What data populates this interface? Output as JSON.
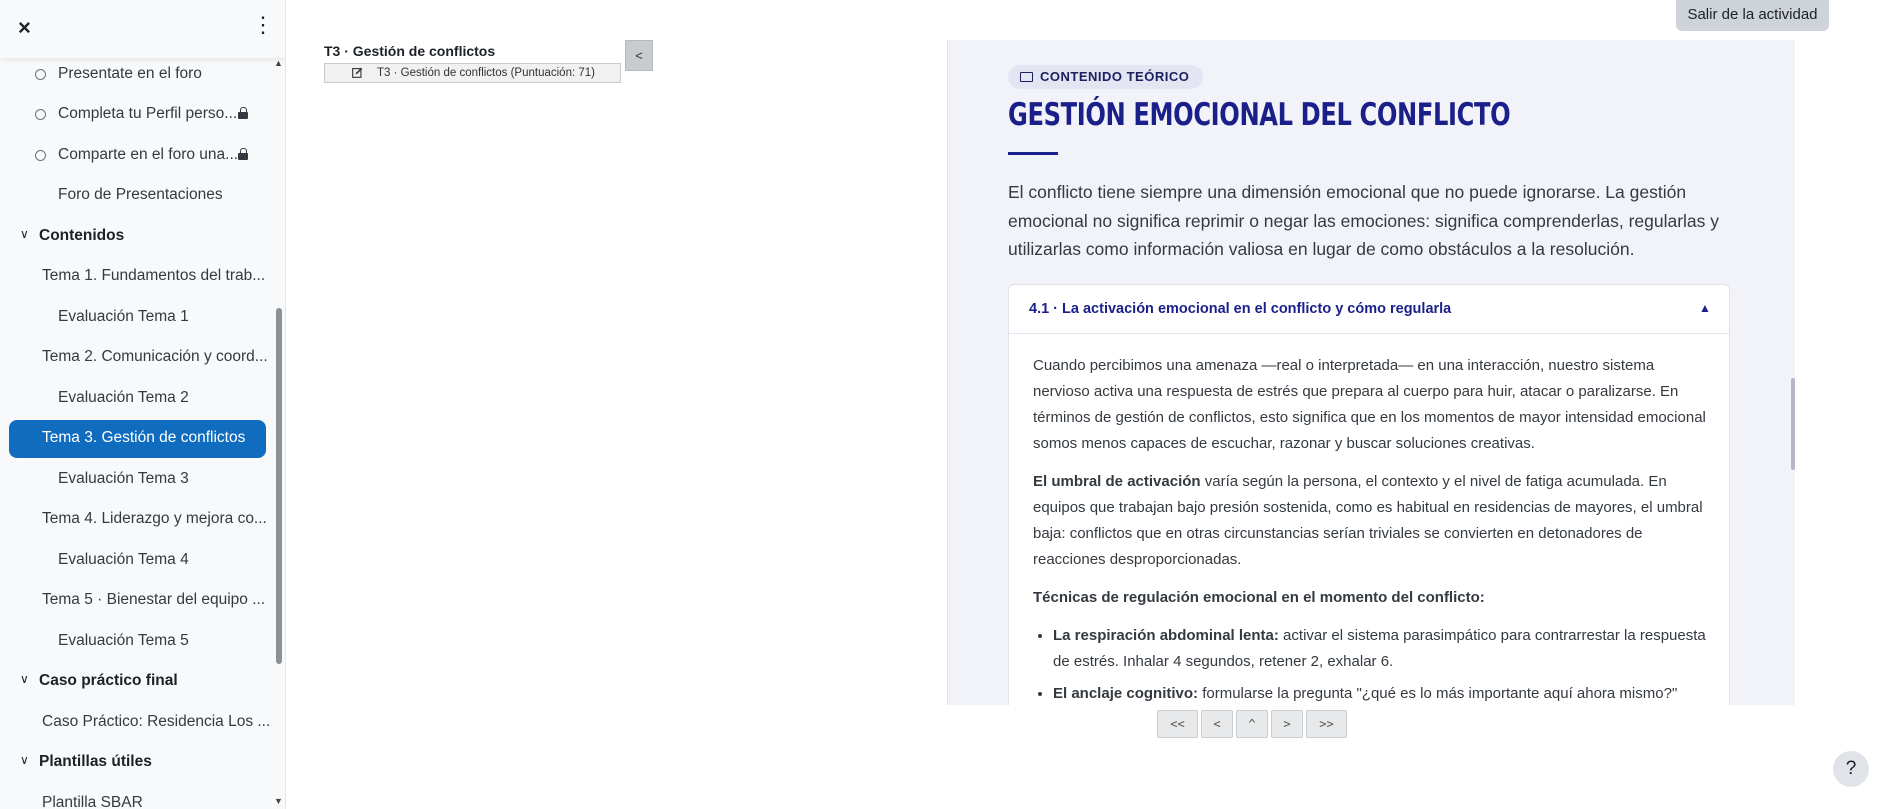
{
  "sidebar": {
    "close_label": "×",
    "menu_label": "⋮",
    "items": [
      {
        "label": "Presentate en el foro",
        "kind": "activity-check"
      },
      {
        "label": "Completa tu Perfil perso...",
        "kind": "activity-check-locked"
      },
      {
        "label": "Comparte en el foro una...",
        "kind": "activity-check-locked"
      },
      {
        "label": "Foro de Presentaciones",
        "kind": "activity"
      },
      {
        "label": "Contenidos",
        "kind": "section"
      },
      {
        "label": "Tema 1. Fundamentos del trab...",
        "kind": "page"
      },
      {
        "label": "Evaluación Tema 1",
        "kind": "activity"
      },
      {
        "label": "Tema 2. Comunicación y coord...",
        "kind": "page"
      },
      {
        "label": "Evaluación Tema 2",
        "kind": "activity"
      },
      {
        "label": "Tema 3. Gestión de conflictos",
        "kind": "page-active"
      },
      {
        "label": "Evaluación Tema 3",
        "kind": "activity"
      },
      {
        "label": "Tema 4. Liderazgo y mejora co...",
        "kind": "page"
      },
      {
        "label": "Evaluación Tema 4",
        "kind": "activity"
      },
      {
        "label": "Tema 5 · Bienestar del equipo ...",
        "kind": "page"
      },
      {
        "label": "Evaluación Tema 5",
        "kind": "activity"
      },
      {
        "label": "Caso práctico final",
        "kind": "section"
      },
      {
        "label": "Caso Práctico: Residencia Los ...",
        "kind": "page"
      },
      {
        "label": "Plantillas útiles",
        "kind": "section"
      },
      {
        "label": "Plantilla SBAR",
        "kind": "page"
      }
    ]
  },
  "header": {
    "exit_label": "Salir de la actividad"
  },
  "activity_nav": {
    "title": "T3 · Gestión de conflictos",
    "item_label": "T3 · Gestión de conflictos (Puntuación: 71)",
    "collapse_label": "<"
  },
  "content": {
    "tag": "CONTENIDO TEÓRICO",
    "title": "GESTIÓN EMOCIONAL DEL CONFLICTO",
    "intro": "El conflicto tiene siempre una dimensión emocional que no puede ignorarse. La gestión emocional no significa reprimir o negar las emociones: significa comprenderlas, regularlas y utilizarlas como información valiosa en lugar de como obstáculos a la resolución.",
    "accordion": {
      "title": "4.1 · La activación emocional en el conflicto y cómo regularla",
      "toggle": "▲",
      "p1": "Cuando percibimos una amenaza —real o interpretada— en una interacción, nuestro sistema nervioso activa una respuesta de estrés que prepara al cuerpo para huir, atacar o paralizarse. En términos de gestión de conflictos, esto significa que en los momentos de mayor intensidad emocional somos menos capaces de escuchar, razonar y buscar soluciones creativas.",
      "p2_bold": "El umbral de activación",
      "p2_rest": " varía según la persona, el contexto y el nivel de fatiga acumulada. En equipos que trabajan bajo presión sostenida, como es habitual en residencias de mayores, el umbral baja: conflictos que en otras circunstancias serían triviales se convierten en detonadores de reacciones desproporcionadas.",
      "p3": "Técnicas de regulación emocional en el momento del conflicto:",
      "li1_bold": "La respiración abdominal lenta:",
      "li1_rest": " activar el sistema parasimpático para contrarrestar la respuesta de estrés. Inhalar 4 segundos, retener 2, exhalar 6.",
      "li2_bold": "El anclaje cognitivo:",
      "li2_rest": " formularse la pregunta \"¿qué es lo más importante aquí ahora mismo?\" para"
    }
  },
  "pager": {
    "first": "<<",
    "prev": "<",
    "up": "^",
    "next": ">",
    "last": ">>"
  },
  "help_label": "?"
}
